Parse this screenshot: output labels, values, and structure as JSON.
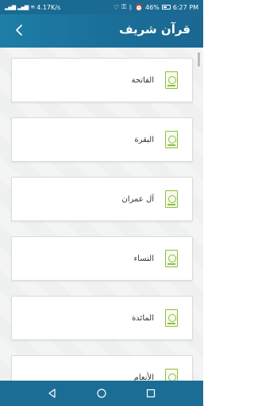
{
  "status_bar": {
    "network_speed": "4.17K/s",
    "battery_percent": "46%",
    "time": "6:27 PM"
  },
  "app_bar": {
    "title": "قرآن شريف"
  },
  "surahs": [
    {
      "name": "الفاتحة"
    },
    {
      "name": "البقرة"
    },
    {
      "name": "آل عمران"
    },
    {
      "name": "النساء"
    },
    {
      "name": "المائدة"
    },
    {
      "name": "الأنعام"
    }
  ],
  "icons": {
    "back": "chevron-left-icon",
    "surah": "quran-book-icon",
    "nav_back": "triangle-back-icon",
    "nav_home": "circle-home-icon",
    "nav_recent": "square-recent-icon"
  },
  "colors": {
    "primary": "#1a6f99",
    "icon_accent": "#8bbf3f",
    "background": "#f3f4f4"
  }
}
